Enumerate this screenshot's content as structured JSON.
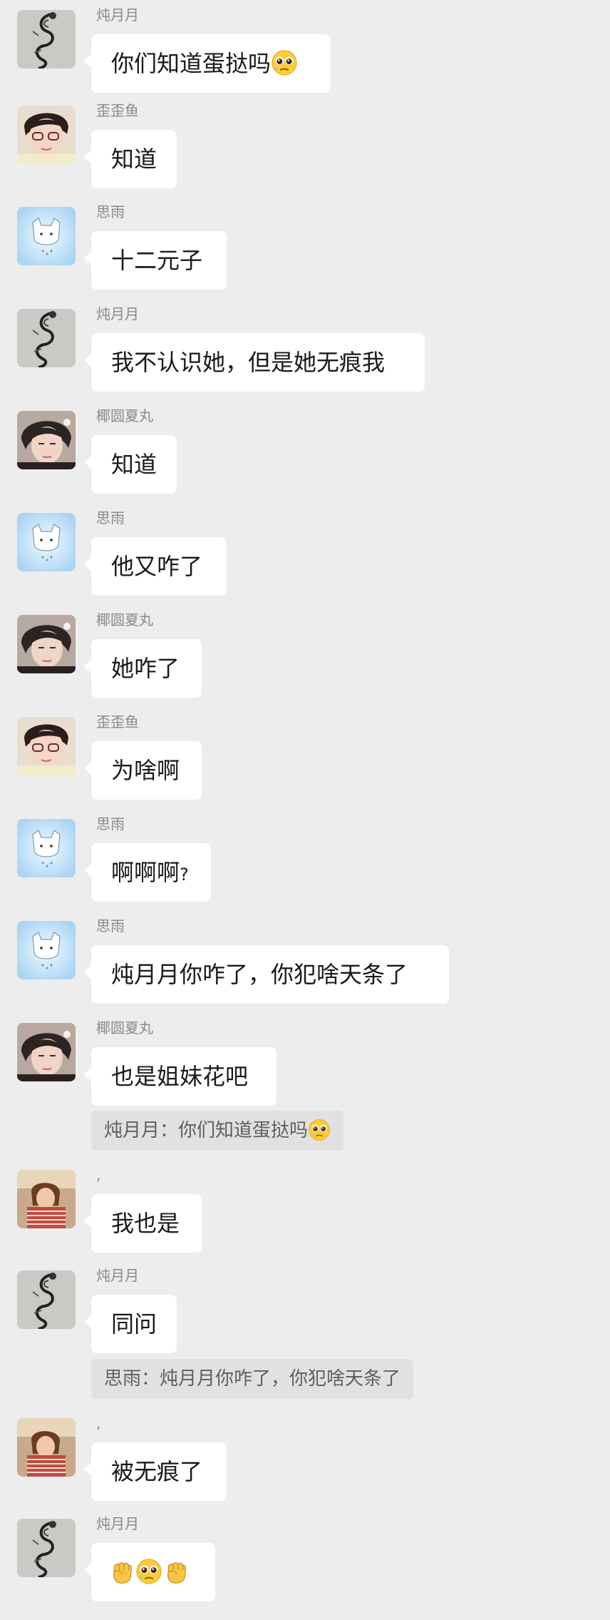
{
  "users": {
    "dun": "炖月月",
    "wai": "歪歪鱼",
    "si": "思雨",
    "ye": "椰圆夏丸",
    "dot": ","
  },
  "messages": [
    {
      "text": "你们知道蛋挞吗",
      "emoji": "pleading-face-icon"
    },
    {
      "text": "知道"
    },
    {
      "text": "十二元子"
    },
    {
      "text": "我不认识她，但是她无痕我"
    },
    {
      "text": "知道"
    },
    {
      "text": "他又咋了"
    },
    {
      "text": "她咋了"
    },
    {
      "text": "为啥啊"
    },
    {
      "text": "啊啊啊",
      "suffix": "?"
    },
    {
      "text": "炖月月你咋了，你犯啥天条了"
    },
    {
      "text": "也是姐妹花吧"
    },
    {
      "text": "我也是"
    },
    {
      "text": "同问"
    },
    {
      "text": "被无痕了"
    },
    {
      "emojis": [
        "fist-icon",
        "pleading-face-icon",
        "fist-icon"
      ]
    }
  ],
  "quotes": [
    {
      "text": "炖月月：你们知道蛋挞吗",
      "emoji": "pleading-face-icon"
    },
    {
      "text": "思雨：炖月月你咋了，你犯啥天条了"
    }
  ],
  "colors": {
    "background": "#ededed",
    "bubble": "#ffffff",
    "quote": "#e1e1e1",
    "name": "#8a8a8a"
  }
}
